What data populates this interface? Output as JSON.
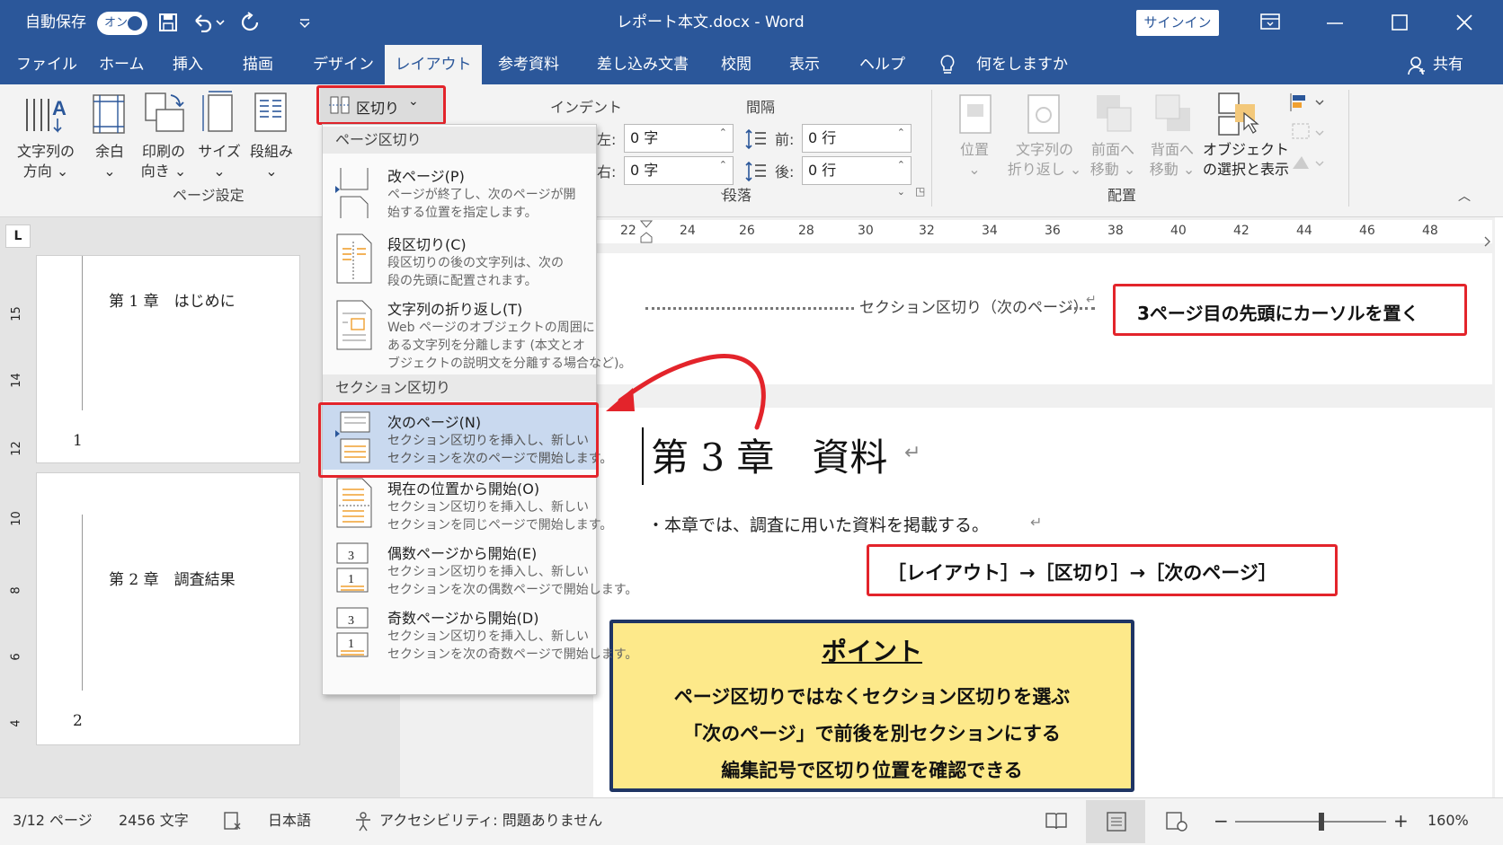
{
  "titlebar": {
    "autosave": "自動保存",
    "toggle": "オン",
    "doc_title": "レポート本文.docx  -  Word",
    "signin": "サインイン"
  },
  "tabs": [
    "ファイル",
    "ホーム",
    "挿入",
    "描画",
    "デザイン",
    "レイアウト",
    "参考資料",
    "差し込み文書",
    "校閲",
    "表示",
    "ヘルプ"
  ],
  "tell_me": "何をしますか",
  "share": "共有",
  "ribbon": {
    "text_direction": [
      "文字列の",
      "方向"
    ],
    "margins": "余白",
    "orientation": [
      "印刷の",
      "向き"
    ],
    "size": "サイズ",
    "columns": "段組み",
    "breaks": "区切り",
    "group_page_setup": "ページ設定",
    "indent": "インデント",
    "spacing": "間隔",
    "left_label": "左:",
    "right_label": "右:",
    "before_label": "前:",
    "after_label": "後:",
    "indent_left": "0 字",
    "indent_right": "0 字",
    "space_before": "0 行",
    "space_after": "0 行",
    "group_paragraph": "段落",
    "position": "位置",
    "wrap_text": [
      "文字列の",
      "折り返し"
    ],
    "bring_forward": [
      "前面へ",
      "移動"
    ],
    "send_backward": [
      "背面へ",
      "移動"
    ],
    "selection_pane": [
      "オブジェクト",
      "の選択と表示"
    ],
    "group_arrange": "配置"
  },
  "menu": {
    "page_breaks_header": "ページ区切り",
    "section_breaks_header": "セクション区切り",
    "items": [
      {
        "title": "改ページ(P)",
        "desc": [
          "ページが終了し、次のページが開",
          "始する位置を指定します。"
        ]
      },
      {
        "title": "段区切り(C)",
        "desc": [
          "段区切りの後の文字列は、次の",
          "段の先頭に配置されます。"
        ]
      },
      {
        "title": "文字列の折り返し(T)",
        "desc": [
          "Web ページのオブジェクトの周囲に",
          "ある文字列を分離します (本文とオ",
          "ブジェクトの説明文を分離する場合など)。"
        ]
      },
      {
        "title": "次のページ(N)",
        "desc": [
          "セクション区切りを挿入し、新しい",
          "セクションを次のページで開始します。"
        ]
      },
      {
        "title": "現在の位置から開始(O)",
        "desc": [
          "セクション区切りを挿入し、新しい",
          "セクションを同じページで開始します。"
        ]
      },
      {
        "title": "偶数ページから開始(E)",
        "desc": [
          "セクション区切りを挿入し、新しい",
          "セクションを次の偶数ページで開始します。"
        ]
      },
      {
        "title": "奇数ページから開始(D)",
        "desc": [
          "セクション区切りを挿入し、新しい",
          "セクションを次の奇数ページで開始します。"
        ]
      }
    ]
  },
  "ruler": [
    "22",
    "24",
    "26",
    "28",
    "30",
    "32",
    "34",
    "36",
    "38",
    "40",
    "42",
    "44",
    "46",
    "48"
  ],
  "vruler": [
    "15",
    "14",
    "12",
    "10",
    "8",
    "6",
    "4"
  ],
  "thumbs": {
    "ch1": "第 1 章　はじめに",
    "page1": "1",
    "ch2": "第 2 章　調査結果",
    "page2": "2"
  },
  "document": {
    "section_break": "セクション区切り（次のページ）",
    "heading": "第 3 章　資料",
    "body": "・本章では、調査に用いた資料を掲載する。"
  },
  "callouts": {
    "cursor_note": "3ページ目の先頭にカーソルを置く",
    "path_note": "［レイアウト］→［区切り］→［次のページ］",
    "point_title": "ポイント",
    "point_lines": [
      "ページ区切りではなくセクション区切りを選ぶ",
      "「次のページ」で前後を別セクションにする",
      "編集記号で区切り位置を確認できる"
    ]
  },
  "status": {
    "page": "3/12 ページ",
    "words": "2456 文字",
    "language": "日本語",
    "accessibility": "アクセシビリティ: 問題ありません",
    "zoom": "160%",
    "zoom_level": 0.57
  },
  "colors": {
    "word_blue": "#2b579a",
    "red": "#e3242b",
    "note_yellow": "#fde98a",
    "note_border": "#1f3564"
  }
}
